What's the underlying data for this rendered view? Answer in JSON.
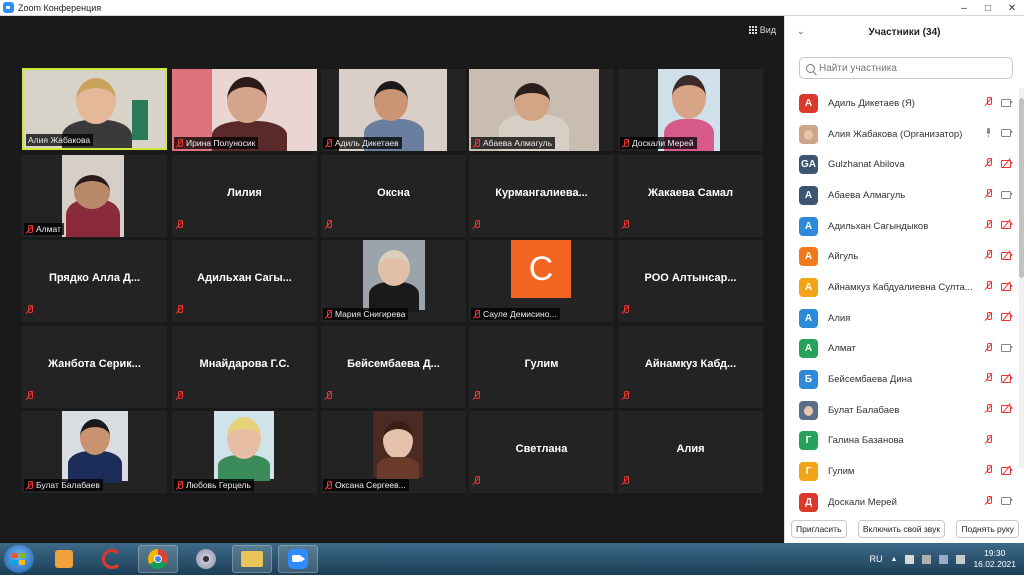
{
  "window": {
    "title": "Zoom Конференция",
    "controls": [
      "–",
      "□",
      "✕"
    ]
  },
  "view_button": {
    "label": "Вид"
  },
  "tiles": [
    {
      "name": "Алия Жабакова",
      "video": true,
      "active": true
    },
    {
      "name": "Ирина Полуносик",
      "video": true
    },
    {
      "name": "Адиль Дикетаев",
      "video": true
    },
    {
      "name": "Абаева Алмагуль",
      "video": true
    },
    {
      "name": "Доскали Мерей",
      "video": true
    },
    {
      "name": "Алмат",
      "video": true
    },
    {
      "name": "Лилия",
      "video": false
    },
    {
      "name": "Оксна",
      "video": false
    },
    {
      "name": "Курмангалиева...",
      "video": false
    },
    {
      "name": "Жакаева Самал",
      "video": false
    },
    {
      "name": "Прядко Алла Д...",
      "video": false
    },
    {
      "name": "Адильхан Сагы...",
      "video": false
    },
    {
      "name": "Мария Снигирева",
      "video": true
    },
    {
      "name": "Сауле Демисино...",
      "video": true,
      "letter": "C"
    },
    {
      "name": "РОО Алтынсар...",
      "video": false
    },
    {
      "name": "Жанбота Серик...",
      "video": false
    },
    {
      "name": "Мнайдарова Г.С.",
      "video": false
    },
    {
      "name": "Бейсембаева Д...",
      "video": false
    },
    {
      "name": "Гулим",
      "video": false
    },
    {
      "name": "Айнамкуз Кабд...",
      "video": false
    },
    {
      "name": "Булат Балабаев",
      "video": true
    },
    {
      "name": "Любовь Герцель",
      "video": true
    },
    {
      "name": "Оксана Сергеев...",
      "video": true
    },
    {
      "name": "Светлана",
      "video": false
    },
    {
      "name": "Алия",
      "video": false
    }
  ],
  "panel": {
    "title": "Участники (34)",
    "search_placeholder": "Найти участника",
    "participants": [
      {
        "initials": "А",
        "color": "#d93a2b",
        "name": "Адиль Дикетаев (Я)",
        "mic": "off",
        "cam": "on"
      },
      {
        "initials": "",
        "color": "#cfa58a",
        "name": "Алия Жабакова (Организатор)",
        "mic": "on",
        "cam": "on",
        "photo": true
      },
      {
        "initials": "GA",
        "color": "#3b5573",
        "name": "Gulzhanat Abilova",
        "mic": "off",
        "cam": "off"
      },
      {
        "initials": "А",
        "color": "#3b5573",
        "name": "Абаева Алмагуль",
        "mic": "off",
        "cam": "on"
      },
      {
        "initials": "А",
        "color": "#2d8ad8",
        "name": "Адильхан Сагындыков",
        "mic": "off",
        "cam": "off"
      },
      {
        "initials": "А",
        "color": "#f07a1a",
        "name": "Айгуль",
        "mic": "off",
        "cam": "off"
      },
      {
        "initials": "А",
        "color": "#f2a316",
        "name": "Айнамкуз Кабдуалиевна Султа...",
        "mic": "off",
        "cam": "off"
      },
      {
        "initials": "А",
        "color": "#2d8ad8",
        "name": "Алия",
        "mic": "off",
        "cam": "off"
      },
      {
        "initials": "А",
        "color": "#25a35a",
        "name": "Алмат",
        "mic": "off",
        "cam": "on"
      },
      {
        "initials": "Б",
        "color": "#2d8ad8",
        "name": "Бейсембаева Дина",
        "mic": "off",
        "cam": "off"
      },
      {
        "initials": "",
        "color": "#5a6e8a",
        "name": "Булат Балабаев",
        "mic": "off",
        "cam": "off",
        "photo": true
      },
      {
        "initials": "Г",
        "color": "#25a35a",
        "name": "Галина Базанова",
        "mic": "off",
        "cam": "none"
      },
      {
        "initials": "Г",
        "color": "#f2a316",
        "name": "Гулим",
        "mic": "off",
        "cam": "off"
      },
      {
        "initials": "Д",
        "color": "#d93a2b",
        "name": "Доскали Мерей",
        "mic": "off",
        "cam": "on"
      }
    ],
    "buttons": {
      "invite": "Пригласить",
      "unmute": "Включить свой звук",
      "raise_hand": "Поднять руку"
    }
  },
  "taskbar": {
    "lang": "RU",
    "time": "19:30",
    "date": "16.02.2021"
  }
}
